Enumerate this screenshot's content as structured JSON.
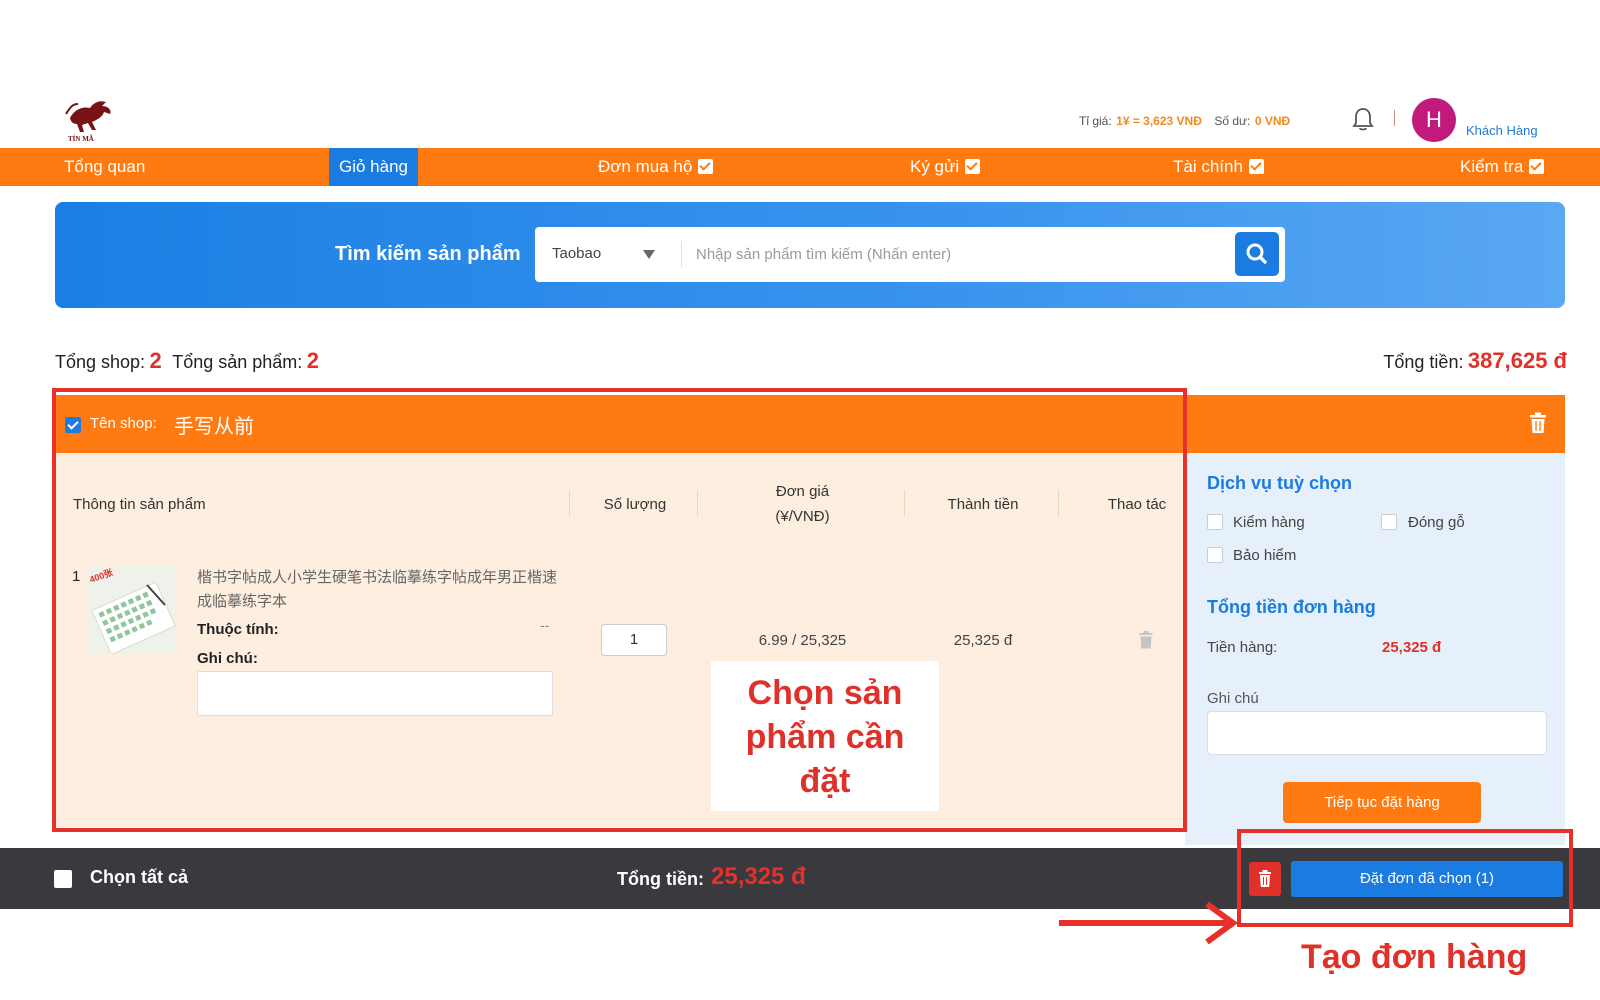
{
  "header": {
    "brand": "TÍN MÃ",
    "rate_label": "Tỉ giá:",
    "rate_value": "1¥ = 3,623 VNĐ",
    "balance_label": "Số dư:",
    "balance_value": "0 VNĐ",
    "avatar_initial": "H",
    "user_name": "Khách Hàng"
  },
  "nav": {
    "items": [
      {
        "label": "Tổng quan",
        "active": false,
        "dropdown": false
      },
      {
        "label": "Giỏ hàng",
        "active": true,
        "dropdown": false
      },
      {
        "label": "Đơn mua hộ",
        "active": false,
        "dropdown": true
      },
      {
        "label": "Ký gửi",
        "active": false,
        "dropdown": true
      },
      {
        "label": "Tài chính",
        "active": false,
        "dropdown": true
      },
      {
        "label": "Kiểm tra",
        "active": false,
        "dropdown": true
      }
    ]
  },
  "search": {
    "title": "Tìm kiếm sản phẩm",
    "platform": "Taobao",
    "placeholder": "Nhập sản phẩm tìm kiếm (Nhấn enter)",
    "icon": "search-icon"
  },
  "summary": {
    "shops_label": "Tổng shop:",
    "shops_value": "2",
    "products_label": "Tổng sản phẩm:",
    "products_value": "2",
    "total_label": "Tổng tiền:",
    "total_value": "387,625 đ"
  },
  "shop": {
    "label": "Tên shop:",
    "name": "手写从前",
    "checked": true,
    "columns": [
      "Thông tin sản phẩm",
      "Số lượng",
      "Đơn giá",
      "(¥/VNĐ)",
      "Thành tiền",
      "Thao tác"
    ],
    "items": [
      {
        "index": "1",
        "name": "楷书字帖成人小学生硬笔书法临摹练字帖成年男正楷速成临摹练字本",
        "image_badge": "400张",
        "attr_label": "Thuộc tính:",
        "attr_value": "--",
        "note_label": "Ghi chú:",
        "quantity": "1",
        "unit_price": "6.99 / 25,325",
        "line_total": "25,325 đ"
      }
    ]
  },
  "side": {
    "services_title": "Dịch vụ tuỳ chọn",
    "services": [
      "Kiểm hàng",
      "Đóng gỗ",
      "Bảo hiểm"
    ],
    "order_total_title": "Tổng tiền đơn hàng",
    "subtotal_label": "Tiền hàng:",
    "subtotal_value": "25,325 đ",
    "note_label": "Ghi chú",
    "continue_label": "Tiếp tục đặt hàng"
  },
  "bottom": {
    "select_all": "Chọn tất cả",
    "total_label": "Tổng tiền:",
    "total_value": "25,325 đ",
    "order_button": "Đặt đơn đã chọn (1)"
  },
  "annotations": {
    "select_products": [
      "Chọn sản",
      "phẩm cần",
      "đặt"
    ],
    "create_order": "Tạo đơn hàng"
  },
  "colors": {
    "brand_orange": "#ff7b12",
    "brand_blue": "#1a7ce0",
    "accent_red": "#e0302a",
    "bar_dark": "#3a3a3e"
  }
}
